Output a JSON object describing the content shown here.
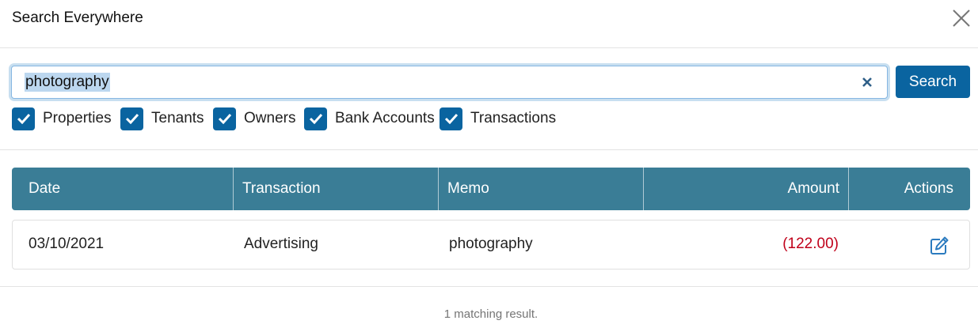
{
  "modal": {
    "title": "Search Everywhere"
  },
  "search": {
    "query": "photography",
    "button_label": "Search"
  },
  "filters": [
    {
      "label": "Properties",
      "checked": true
    },
    {
      "label": "Tenants",
      "checked": true
    },
    {
      "label": "Owners",
      "checked": true
    },
    {
      "label": "Bank Accounts",
      "checked": true
    },
    {
      "label": "Transactions",
      "checked": true
    }
  ],
  "table": {
    "columns": [
      "Date",
      "Transaction",
      "Memo",
      "Amount",
      "Actions"
    ],
    "rows": [
      {
        "date": "03/10/2021",
        "transaction": "Advertising",
        "memo": "photography",
        "amount": "(122.00)"
      }
    ]
  },
  "footer": {
    "result_text": "1 matching result."
  },
  "colors": {
    "primary": "#0a64a0",
    "table_header": "#3a7d96",
    "negative_amount": "#c0001a"
  },
  "icons": {
    "close": "close-icon",
    "clear": "clear-icon",
    "checkbox": "check-icon",
    "edit": "edit-icon"
  }
}
